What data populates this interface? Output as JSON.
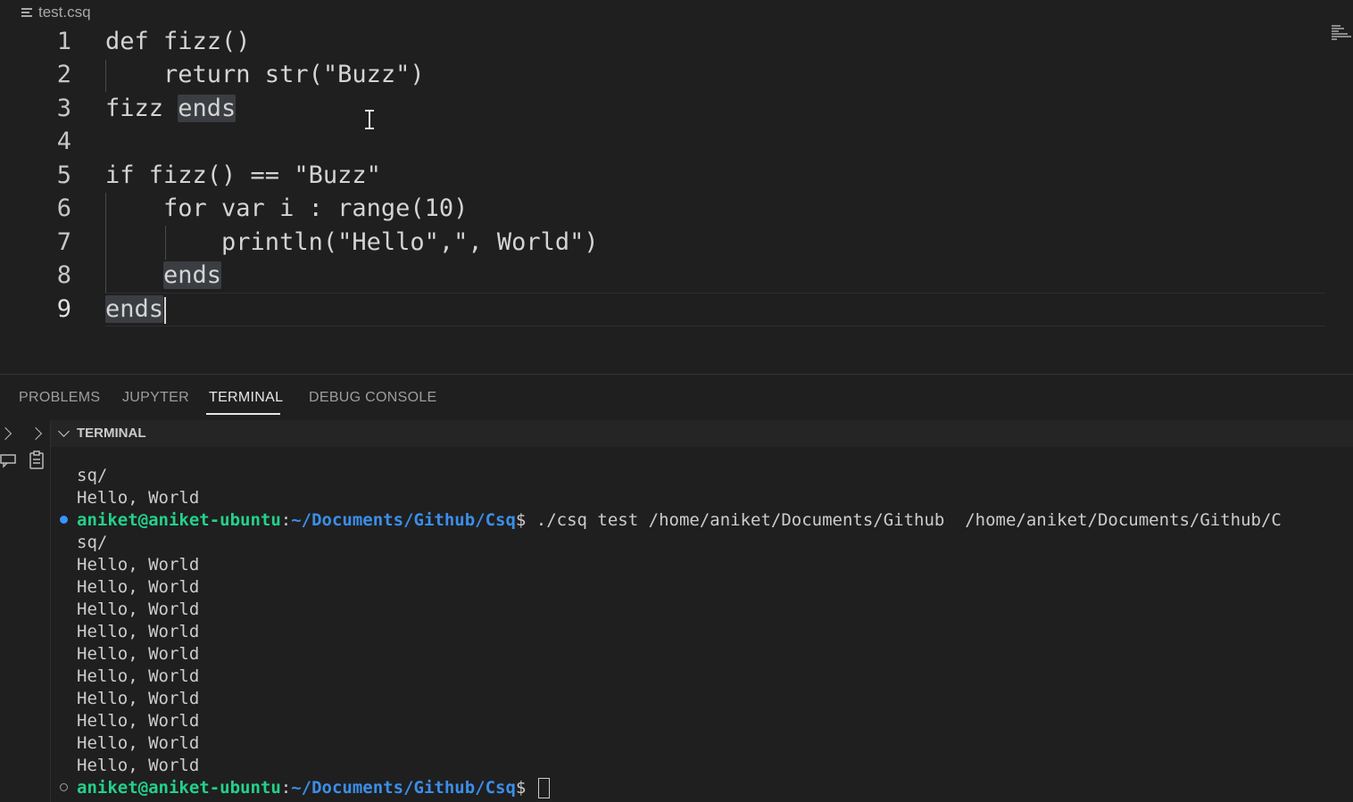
{
  "editor": {
    "filename": "test.csq",
    "lines": [
      {
        "n": "1",
        "text": "def fizz()"
      },
      {
        "n": "2",
        "text": "    return str(\"Buzz\")"
      },
      {
        "n": "3",
        "pre": "fizz ",
        "hl": "ends"
      },
      {
        "n": "4",
        "text": ""
      },
      {
        "n": "5",
        "text": "if fizz() == \"Buzz\""
      },
      {
        "n": "6",
        "text": "    for var i : range(10)"
      },
      {
        "n": "7",
        "text": "        println(\"Hello\",\", World\")"
      },
      {
        "n": "8",
        "pre": "    ",
        "hl": "ends"
      },
      {
        "n": "9",
        "pre": "",
        "hl": "ends"
      }
    ]
  },
  "panel": {
    "tabs": [
      "PROBLEMS",
      "JUPYTER",
      "TERMINAL",
      "DEBUG CONSOLE"
    ],
    "active_tab": "TERMINAL",
    "terminal_title": "TERMINAL"
  },
  "terminal": {
    "user": "aniket@aniket-ubuntu",
    "path": "~/Documents/Github/Csq",
    "lines": [
      "sq/",
      "Hello, World"
    ],
    "command": "./csq test /home/aniket/Documents/Github  /home/aniket/Documents/Github/C",
    "output": [
      "sq/",
      "Hello, World",
      "Hello, World",
      "Hello, World",
      "Hello, World",
      "Hello, World",
      "Hello, World",
      "Hello, World",
      "Hello, World",
      "Hello, World",
      "Hello, World"
    ]
  },
  "colors": {
    "user": "#23d18b",
    "path": "#3b8eea",
    "background": "#1f1f1f"
  }
}
